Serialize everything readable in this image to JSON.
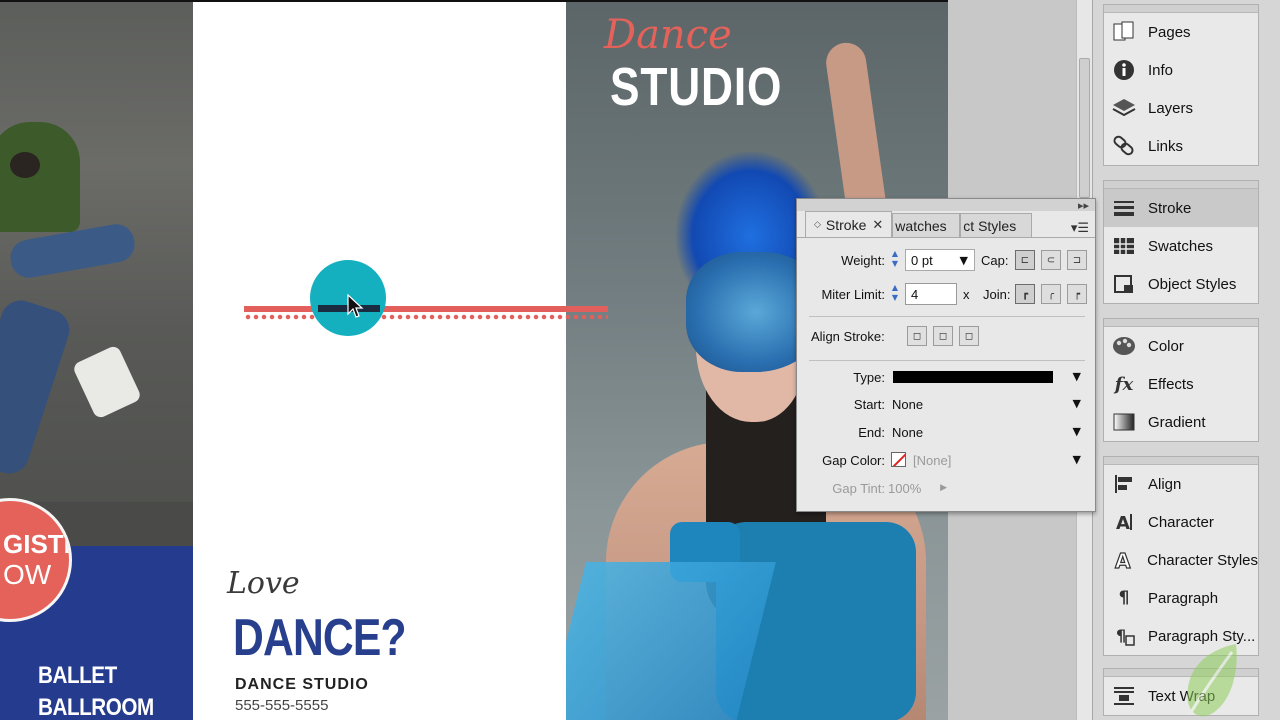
{
  "document": {
    "right_script_title": "Dance",
    "right_title": "STUDIO",
    "badge_line1": "GISTER",
    "badge_line2": "OW",
    "left_list": [
      "BALLET",
      "BALLROOM"
    ],
    "love": "Love",
    "dance_question": "DANCE?",
    "studio_name": "DANCE STUDIO",
    "phone": "555-555-5555",
    "colors": {
      "accent_red": "#e35f5c",
      "accent_blue": "#253c8e",
      "accent_cyan": "#15b0c0"
    }
  },
  "dock": {
    "group1": [
      {
        "label": "Pages",
        "icon": "pages-icon"
      },
      {
        "label": "Info",
        "icon": "info-icon"
      },
      {
        "label": "Layers",
        "icon": "layers-icon"
      },
      {
        "label": "Links",
        "icon": "links-icon"
      }
    ],
    "group2": [
      {
        "label": "Stroke",
        "icon": "stroke-icon",
        "active": true
      },
      {
        "label": "Swatches",
        "icon": "swatches-icon"
      },
      {
        "label": "Object Styles",
        "icon": "object-styles-icon"
      }
    ],
    "group3": [
      {
        "label": "Color",
        "icon": "color-icon"
      },
      {
        "label": "Effects",
        "icon": "effects-icon"
      },
      {
        "label": "Gradient",
        "icon": "gradient-icon"
      }
    ],
    "group4": [
      {
        "label": "Align",
        "icon": "align-icon"
      },
      {
        "label": "Character",
        "icon": "character-icon"
      },
      {
        "label": "Character Styles",
        "icon": "character-styles-icon"
      },
      {
        "label": "Paragraph",
        "icon": "paragraph-icon"
      },
      {
        "label": "Paragraph Sty...",
        "icon": "paragraph-styles-icon"
      }
    ],
    "group5": [
      {
        "label": "Text Wrap",
        "icon": "text-wrap-icon"
      }
    ]
  },
  "stroke_panel": {
    "tabs": [
      "Stroke",
      "watches",
      "ct Styles"
    ],
    "weight_label": "Weight:",
    "weight_value": "0 pt",
    "cap_label": "Cap:",
    "miter_label": "Miter Limit:",
    "miter_value": "4",
    "x_label": "x",
    "join_label": "Join:",
    "align_label": "Align Stroke:",
    "type_label": "Type:",
    "start_label": "Start:",
    "start_value": "None",
    "end_label": "End:",
    "end_value": "None",
    "gap_color_label": "Gap Color:",
    "gap_color_value": "[None]",
    "gap_tint_label": "Gap Tint:",
    "gap_tint_value": "100%"
  }
}
